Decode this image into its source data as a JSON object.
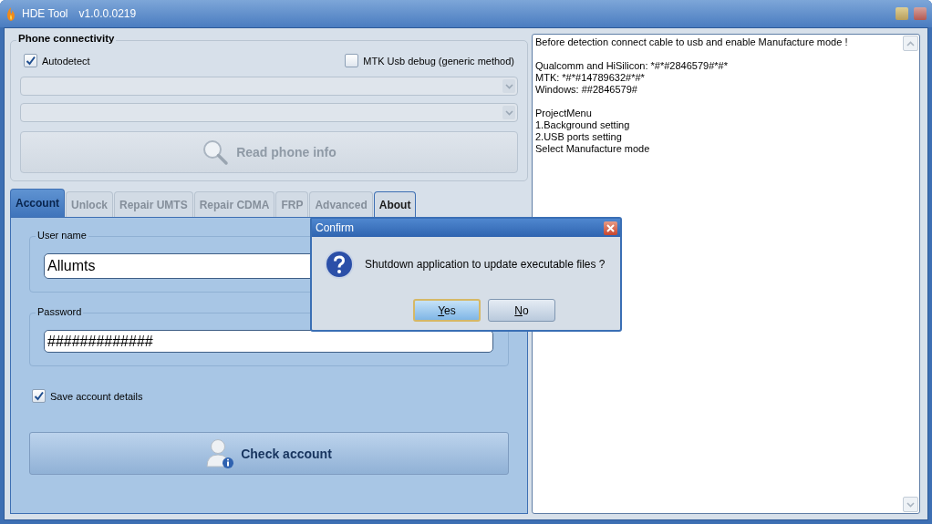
{
  "window": {
    "title": "HDE Tool",
    "version": "v1.0.0.0219"
  },
  "phone_connectivity": {
    "title": "Phone connectivity",
    "autodetect": {
      "label": "Autodetect",
      "checked": true
    },
    "mtk_debug": {
      "label": "MTK Usb debug (generic method)",
      "checked": false
    },
    "dropdowns": [
      {
        "disabled": true
      },
      {
        "disabled": true
      }
    ],
    "read_button": {
      "label": "Read phone info",
      "disabled": true
    }
  },
  "tabs": [
    {
      "label": "Account",
      "selected": true,
      "disabled": false
    },
    {
      "label": "Unlock",
      "selected": false,
      "disabled": true
    },
    {
      "label": "Repair UMTS",
      "selected": false,
      "disabled": true
    },
    {
      "label": "Repair CDMA",
      "selected": false,
      "disabled": true
    },
    {
      "label": "FRP",
      "selected": false,
      "disabled": true
    },
    {
      "label": "Advanced",
      "selected": false,
      "disabled": true
    },
    {
      "label": "About",
      "selected": false,
      "disabled": false
    }
  ],
  "account": {
    "username": {
      "label": "User name",
      "value": "Allumts"
    },
    "password": {
      "label": "Password",
      "value": "#############"
    },
    "save_details": {
      "label": "Save account details",
      "checked": true
    },
    "check_button": {
      "label": "Check account"
    }
  },
  "log": {
    "paragraphs": [
      [
        "Before detection connect cable to usb and enable Manufacture mode !"
      ],
      [
        "Qualcomm and HiSilicon: *#*#2846579#*#*",
        "MTK: *#*#14789632#*#*",
        "Windows: ##2846579#"
      ],
      [
        "ProjectMenu",
        "1.Background setting",
        "2.USB ports setting",
        "Select Manufacture mode"
      ]
    ]
  },
  "dialog": {
    "title": "Confirm",
    "message": "Shutdown application to update executable files ?",
    "buttons": [
      {
        "label": "Yes",
        "selected": true
      },
      {
        "label": "No",
        "selected": false
      }
    ]
  }
}
